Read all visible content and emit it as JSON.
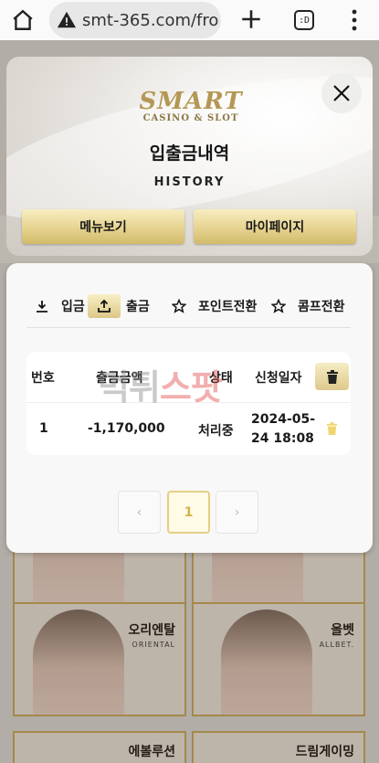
{
  "browser": {
    "url": "smt-365.com/fro",
    "tab_count": ":D"
  },
  "header": {
    "logo_main": "SMART",
    "logo_sub": "CASINO & SLOT",
    "title": "입출금내역",
    "subtitle": "HISTORY",
    "buttons": [
      "메뉴보기",
      "마이페이지"
    ]
  },
  "tabs": [
    {
      "label": "입금",
      "icon": "download-icon",
      "active": false
    },
    {
      "label": "출금",
      "icon": "upload-icon",
      "active": true
    },
    {
      "label": "포인트전환",
      "icon": "star-icon",
      "active": false
    },
    {
      "label": "콤프전환",
      "icon": "star-icon",
      "active": false
    }
  ],
  "table": {
    "headers": [
      "번호",
      "출금금액",
      "상태",
      "신청일자"
    ],
    "rows": [
      {
        "no": "1",
        "amount": "-1,170,000",
        "status": "처리중",
        "date_line1": "2024-05-",
        "date_line2": "24 18:08"
      }
    ]
  },
  "pagination": {
    "prev": "‹",
    "current": "1",
    "next": "›"
  },
  "watermark": {
    "part1": "먹튀",
    "part2": "스팟"
  },
  "background_games": [
    {
      "name": "오리엔탈",
      "sub": "ORIENTAL"
    },
    {
      "name": "올벳",
      "sub": "ALLBET."
    },
    {
      "name": "에볼루션",
      "sub": ""
    },
    {
      "name": "드림게이밍",
      "sub": ""
    }
  ],
  "colors": {
    "gold": "#dcc786",
    "accent_page": "#d4b34c"
  }
}
